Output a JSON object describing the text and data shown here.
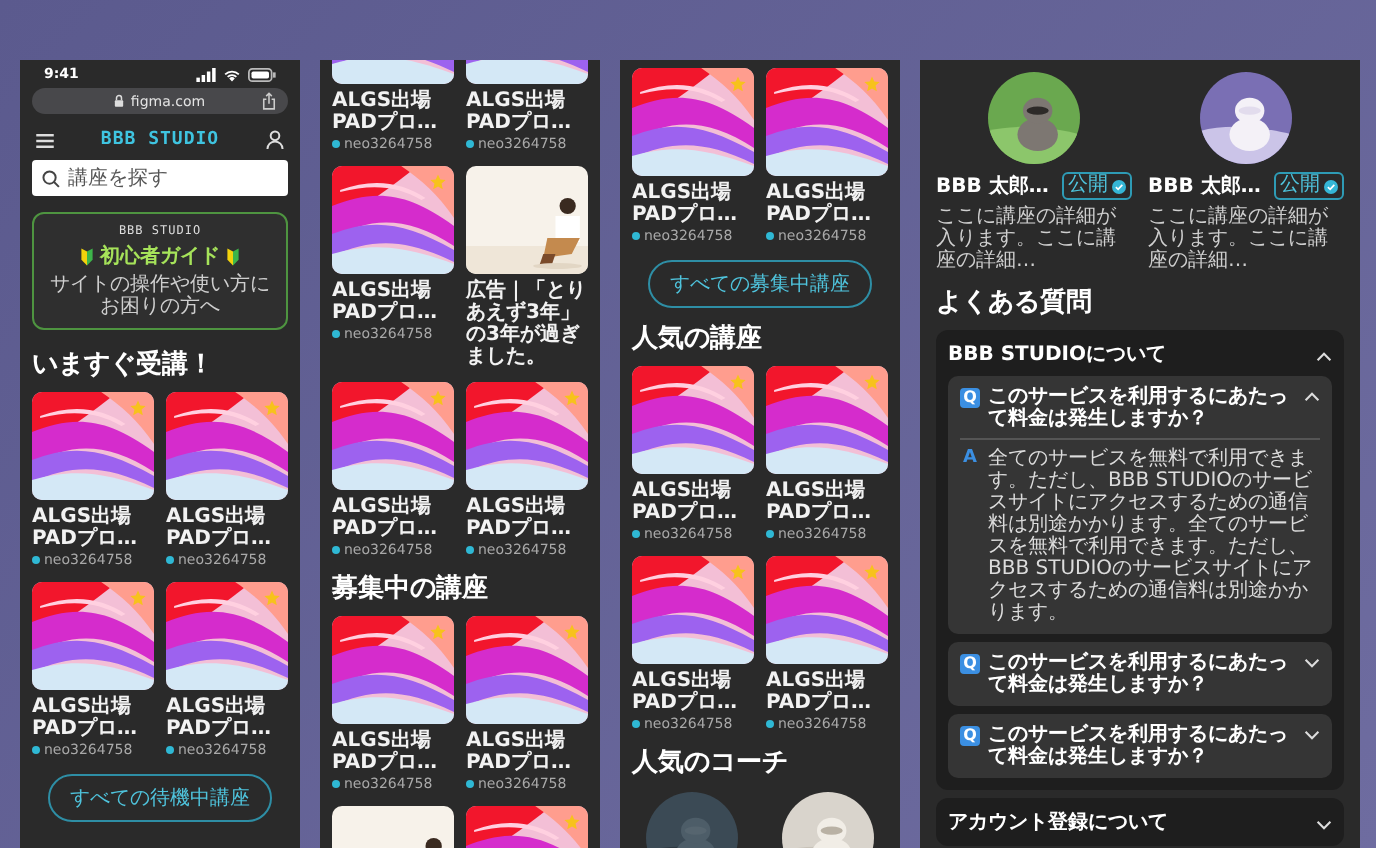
{
  "phones": [
    {
      "blocks": [
        {
          "kind": "status_bar",
          "time": "9:41"
        },
        {
          "kind": "address_bar",
          "url": "figma.com"
        },
        {
          "kind": "header",
          "logo": "BBB STUDIO"
        },
        {
          "kind": "search",
          "placeholder": "講座を探す"
        },
        {
          "kind": "guide",
          "brand": "BBB STUDIO",
          "title": "初心者ガイド",
          "subtitle": "サイトの操作や使い方にお困りの方へ"
        },
        {
          "kind": "heading",
          "text": "いますぐ受講！"
        },
        {
          "kind": "cards",
          "items": [
            {
              "kind": "course",
              "title": "ALGS出場PADプロ…",
              "author": "neo3264758"
            },
            {
              "kind": "course",
              "title": "ALGS出場PADプロ…",
              "author": "neo3264758"
            },
            {
              "kind": "course",
              "title": "ALGS出場PADプロ…",
              "author": "neo3264758"
            },
            {
              "kind": "course",
              "title": "ALGS出場PADプロ…",
              "author": "neo3264758"
            }
          ]
        },
        {
          "kind": "button",
          "label": "すべての待機中講座"
        }
      ]
    },
    {
      "blocks": [
        {
          "kind": "cards",
          "items": [
            {
              "kind": "course",
              "title": "ALGS出場PADプロ…",
              "author": "neo3264758",
              "starred": false
            },
            {
              "kind": "course",
              "title": "ALGS出場PADプロ…",
              "author": "neo3264758",
              "starred": false
            },
            {
              "kind": "course",
              "title": "ALGS出場PADプロ…",
              "author": "neo3264758"
            },
            {
              "kind": "ad",
              "title": "広告｜「とりあえず3年」の3年が過ぎました。"
            },
            {
              "kind": "course",
              "title": "ALGS出場PADプロ…",
              "author": "neo3264758"
            },
            {
              "kind": "course",
              "title": "ALGS出場PADプロ…",
              "author": "neo3264758"
            }
          ]
        },
        {
          "kind": "heading",
          "text": "募集中の講座"
        },
        {
          "kind": "cards",
          "items": [
            {
              "kind": "course",
              "title": "ALGS出場PADプロ…",
              "author": "neo3264758"
            },
            {
              "kind": "course",
              "title": "ALGS出場PADプロ…",
              "author": "neo3264758"
            },
            {
              "kind": "ad"
            },
            {
              "kind": "course"
            }
          ]
        }
      ]
    },
    {
      "blocks": [
        {
          "kind": "cards",
          "items": [
            {
              "kind": "course",
              "title": "ALGS出場PADプロ…",
              "author": "neo3264758"
            },
            {
              "kind": "course",
              "title": "ALGS出場PADプロ…",
              "author": "neo3264758"
            }
          ]
        },
        {
          "kind": "button",
          "label": "すべての募集中講座"
        },
        {
          "kind": "heading",
          "text": "人気の講座"
        },
        {
          "kind": "cards",
          "items": [
            {
              "kind": "course",
              "title": "ALGS出場PADプロ…",
              "author": "neo3264758"
            },
            {
              "kind": "course",
              "title": "ALGS出場PADプロ…",
              "author": "neo3264758"
            },
            {
              "kind": "course",
              "title": "ALGS出場PADプロ…",
              "author": "neo3264758"
            },
            {
              "kind": "course",
              "title": "ALGS出場PADプロ…",
              "author": "neo3264758"
            }
          ]
        },
        {
          "kind": "heading",
          "text": "人気のコーチ"
        },
        {
          "kind": "coaches"
        }
      ]
    },
    {
      "blocks": [
        {
          "kind": "coaches",
          "items": [
            {
              "kind": "picture",
              "name": "BBB 太郎…",
              "badge": "公開",
              "description": "ここに講座の詳細が入ります。ここに講座の詳細…"
            },
            {
              "kind": "picture",
              "name": "BBB 太郎…",
              "badge": "公開",
              "description": "ここに講座の詳細が入ります。ここに講座の詳細…"
            }
          ]
        },
        {
          "kind": "heading",
          "text": "よくある質問"
        },
        {
          "kind": "faq",
          "groups": [
            {
              "title": "BBB STUDIOについて",
              "expanded": true,
              "items": [
                {
                  "mark": "Q",
                  "question": "このサービスを利用するにあたって料金は発生しますか？",
                  "expanded": true,
                  "answer_mark": "A",
                  "answer": "全てのサービスを無料で利用できます。ただし、BBB STUDIOのサービスサイトにアクセスするための通信料は別途かかります。全てのサービスを無料で利用できます。ただし、BBB STUDIOのサービスサイトにアクセスするための通信料は別途かかります。"
                },
                {
                  "mark": "Q",
                  "question": "このサービスを利用するにあたって料金は発生しますか？",
                  "expanded": false
                },
                {
                  "mark": "Q",
                  "question": "このサービスを利用するにあたって料金は発生しますか？",
                  "expanded": false
                }
              ]
            },
            {
              "title": "アカウント登録について",
              "expanded": false
            }
          ]
        }
      ]
    }
  ]
}
